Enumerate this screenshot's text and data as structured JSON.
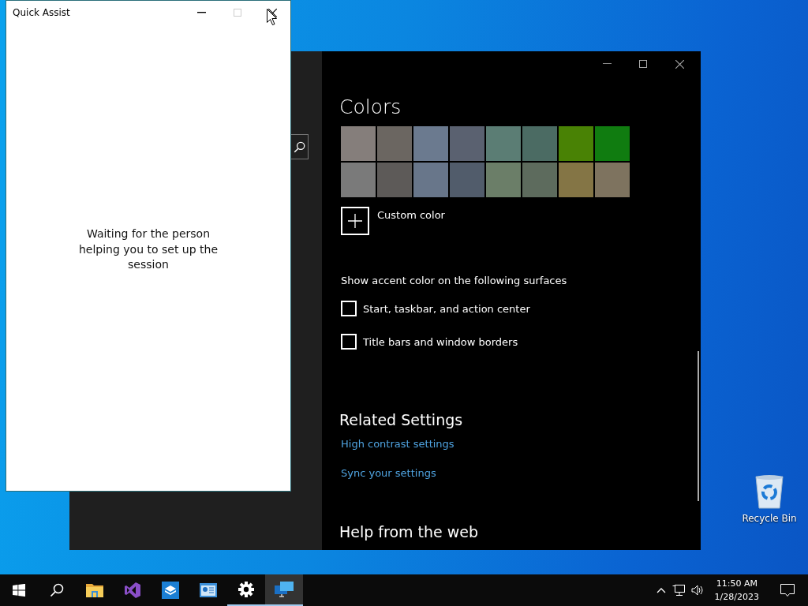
{
  "quick_assist": {
    "title": "Quick Assist",
    "message": "Waiting for the person helping you to set up the session"
  },
  "settings": {
    "heading": "Colors",
    "swatches": [
      {
        "color": "#857e7b"
      },
      {
        "color": "#6b6661"
      },
      {
        "color": "#6b7a8f"
      },
      {
        "color": "#5a6170"
      },
      {
        "color": "#5b7d74"
      },
      {
        "color": "#4b6b63"
      },
      {
        "color": "#498205"
      },
      {
        "color": "#107c10"
      },
      {
        "color": "#7a7a7a"
      },
      {
        "color": "#5d5a58"
      },
      {
        "color": "#68768a"
      },
      {
        "color": "#515c6b"
      },
      {
        "color": "#6b7e68"
      },
      {
        "color": "#5d6b5d"
      },
      {
        "color": "#847545"
      },
      {
        "color": "#7e735f"
      }
    ],
    "custom_color": "Custom color",
    "surfaces_heading": "Show accent color on the following surfaces",
    "checkboxes": [
      {
        "label": "Start, taskbar, and action center",
        "checked": false
      },
      {
        "label": "Title bars and window borders",
        "checked": false
      }
    ],
    "related_heading": "Related Settings",
    "links": [
      "High contrast settings",
      "Sync your settings"
    ],
    "help_heading": "Help from the web"
  },
  "desktop_icons": [
    {
      "label": "Recycle Bin"
    }
  ],
  "taskbar": {
    "apps": [
      {
        "kind": "start",
        "selected": false,
        "running": false
      },
      {
        "kind": "search",
        "selected": false,
        "running": false
      },
      {
        "kind": "folder",
        "selected": false,
        "running": false
      },
      {
        "kind": "loop",
        "selected": false,
        "running": false
      },
      {
        "kind": "box",
        "selected": false,
        "running": false
      },
      {
        "kind": "card",
        "selected": false,
        "running": false
      },
      {
        "kind": "gear",
        "selected": false,
        "running": true
      },
      {
        "kind": "monitors",
        "selected": true,
        "running": true
      }
    ],
    "time": "11:50 AM",
    "date": "1/28/2023"
  }
}
